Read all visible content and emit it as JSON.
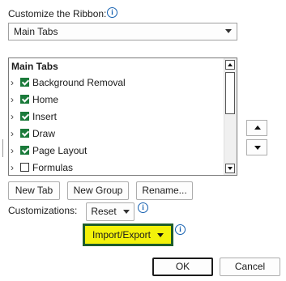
{
  "header": {
    "label": "Customize the Ribbon:"
  },
  "dropdown": {
    "value": "Main Tabs"
  },
  "tree": {
    "header": "Main Tabs",
    "items": [
      {
        "label": "Background Removal",
        "checked": true
      },
      {
        "label": "Home",
        "checked": true
      },
      {
        "label": "Insert",
        "checked": true
      },
      {
        "label": "Draw",
        "checked": true
      },
      {
        "label": "Page Layout",
        "checked": true
      },
      {
        "label": "Formulas",
        "checked": false
      }
    ]
  },
  "buttons": {
    "new_tab": "New Tab",
    "new_group": "New Group",
    "rename": "Rename...",
    "reset": "Reset",
    "import_export": "Import/Export",
    "ok": "OK",
    "cancel": "Cancel"
  },
  "customizations_label": "Customizations:",
  "colors": {
    "highlight": "#f3f20a",
    "highlight_border": "#1f5d2c",
    "checkbox_checked": "#1a7a3a"
  }
}
